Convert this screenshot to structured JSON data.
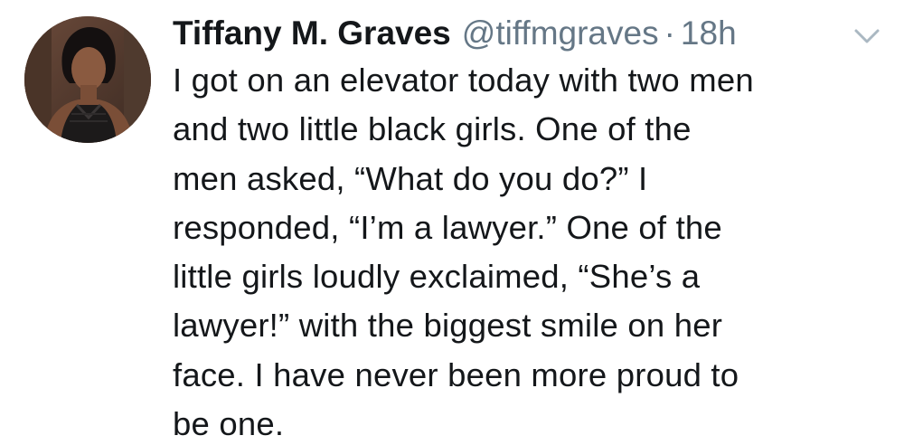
{
  "tweet": {
    "author_name": "Tiffany M. Graves",
    "author_handle": "@tiffmgraves",
    "separator": "·",
    "timestamp": "18h",
    "caret_icon": "chevron-down-icon",
    "avatar_icon": "profile-photo",
    "text_lines": [
      "I got on an elevator today with two men",
      "and two little black girls. One of the",
      "men asked, “What do you do?” I",
      "responded, “I’m a lawyer.” One of the",
      "little girls loudly exclaimed, “She’s a",
      "lawyer!” with the biggest smile on her",
      "face. I have never been more proud to",
      "be one."
    ]
  },
  "colors": {
    "text_primary": "#14171a",
    "text_secondary": "#657786",
    "background": "#ffffff"
  }
}
